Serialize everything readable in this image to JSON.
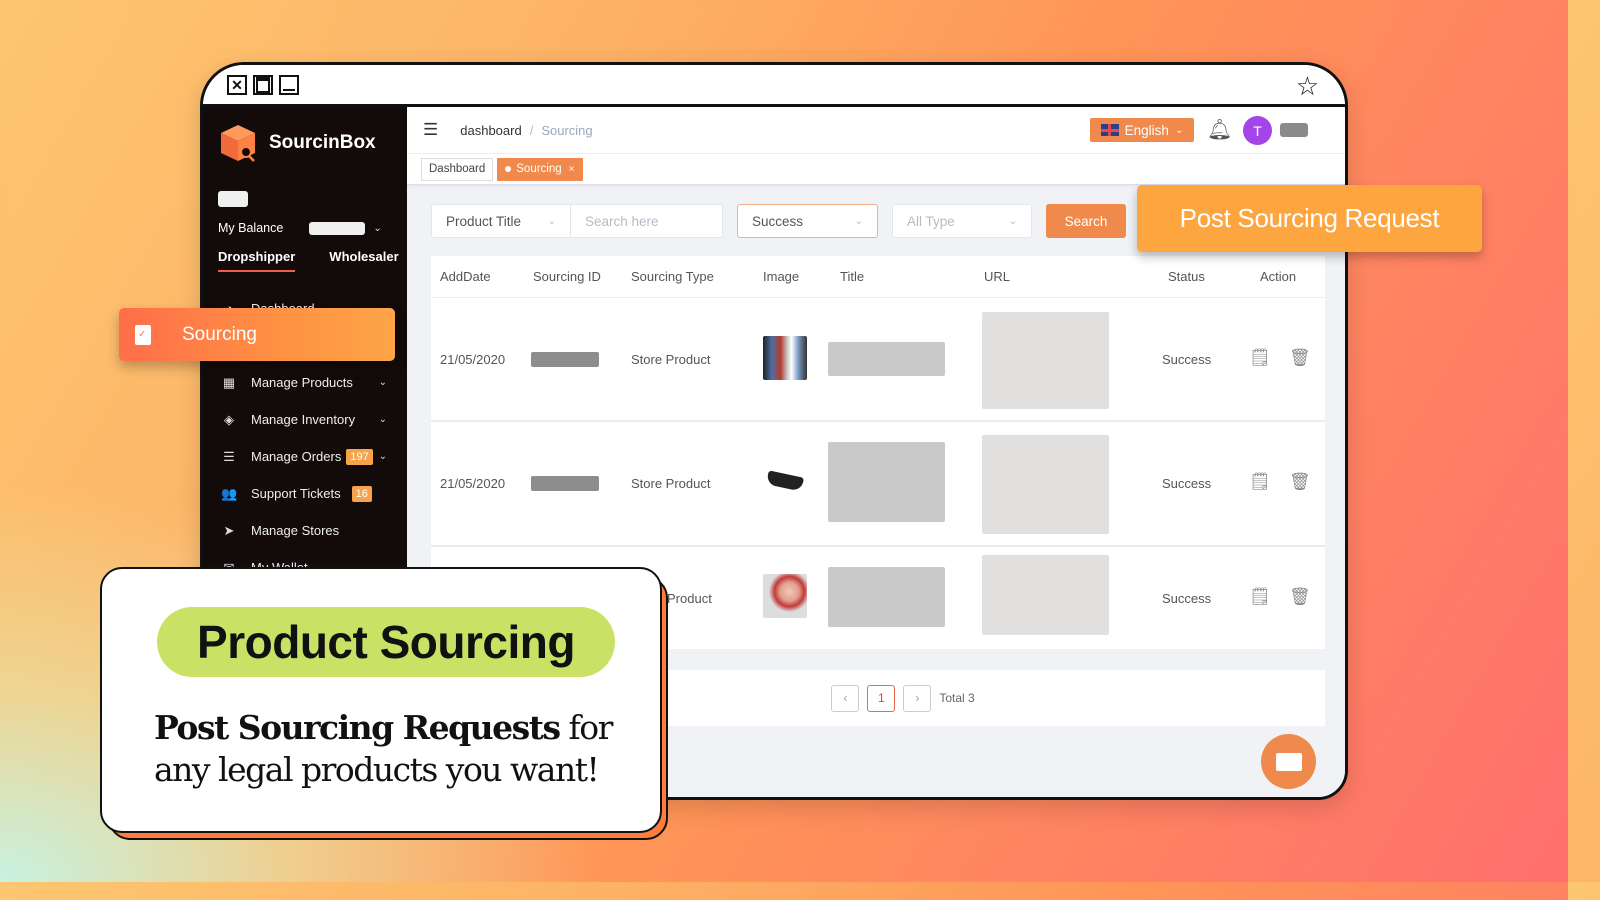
{
  "window": {
    "controls": [
      "close",
      "restore",
      "minimize"
    ],
    "bookmark_icon": "star-icon"
  },
  "brand": {
    "name": "SourcinBox",
    "accent": "#EF8A4C"
  },
  "sidebar": {
    "balance_label": "My Balance",
    "roles": [
      {
        "label": "Dropshipper",
        "active": true
      },
      {
        "label": "Wholesaler",
        "active": false
      }
    ],
    "items": [
      {
        "label": "Dashboard",
        "icon": "gauge-icon",
        "has_submenu": false
      },
      {
        "label": "Sourcing",
        "icon": "clipboard-check-icon",
        "active": true
      },
      {
        "label": "Manage Products",
        "icon": "grid-icon",
        "has_submenu": true
      },
      {
        "label": "Manage Inventory",
        "icon": "layers-icon",
        "has_submenu": true
      },
      {
        "label": "Manage Orders",
        "icon": "list-icon",
        "badge": "197",
        "has_submenu": true
      },
      {
        "label": "Support Tickets",
        "icon": "users-icon",
        "badge": "16",
        "has_submenu": false
      },
      {
        "label": "Manage Stores",
        "icon": "send-icon",
        "has_submenu": false
      },
      {
        "label": "My Wallet",
        "icon": "mail-icon",
        "has_submenu": true
      }
    ]
  },
  "header": {
    "breadcrumb": {
      "home": "dashboard",
      "separator": "/",
      "current": "Sourcing"
    },
    "language": "English",
    "user_initial": "T"
  },
  "tabs": [
    {
      "label": "Dashboard",
      "active": false
    },
    {
      "label": "Sourcing",
      "active": true,
      "close": "×"
    }
  ],
  "filters": {
    "field_select": "Product Title",
    "search_placeholder": "Search here",
    "status_select": "Success",
    "type_placeholder": "All Type",
    "search_button": "Search"
  },
  "table": {
    "columns": [
      "AddDate",
      "Sourcing ID",
      "Sourcing Type",
      "Image",
      "Title",
      "URL",
      "Status",
      "Action"
    ],
    "rows": [
      {
        "add_date": "21/05/2020",
        "sourcing_type": "Store Product",
        "image": "fashion-photo",
        "status": "Success"
      },
      {
        "add_date": "21/05/2020",
        "sourcing_type": "Store Product",
        "image": "sunglasses-photo",
        "status": "Success"
      },
      {
        "add_date": "",
        "sourcing_type": "Product",
        "image": "baby-headband-photo",
        "status": "Success"
      }
    ]
  },
  "pagination": {
    "current_page": "1",
    "total_label": "Total 3",
    "prev": "‹",
    "next": "›"
  },
  "overlays": {
    "post_request_button": "Post Sourcing Request",
    "sourcing_highlight": "Sourcing",
    "card_title": "Product Sourcing",
    "card_text_bold": "Post Sourcing Requests",
    "card_text_rest": " for any legal products you want!"
  }
}
